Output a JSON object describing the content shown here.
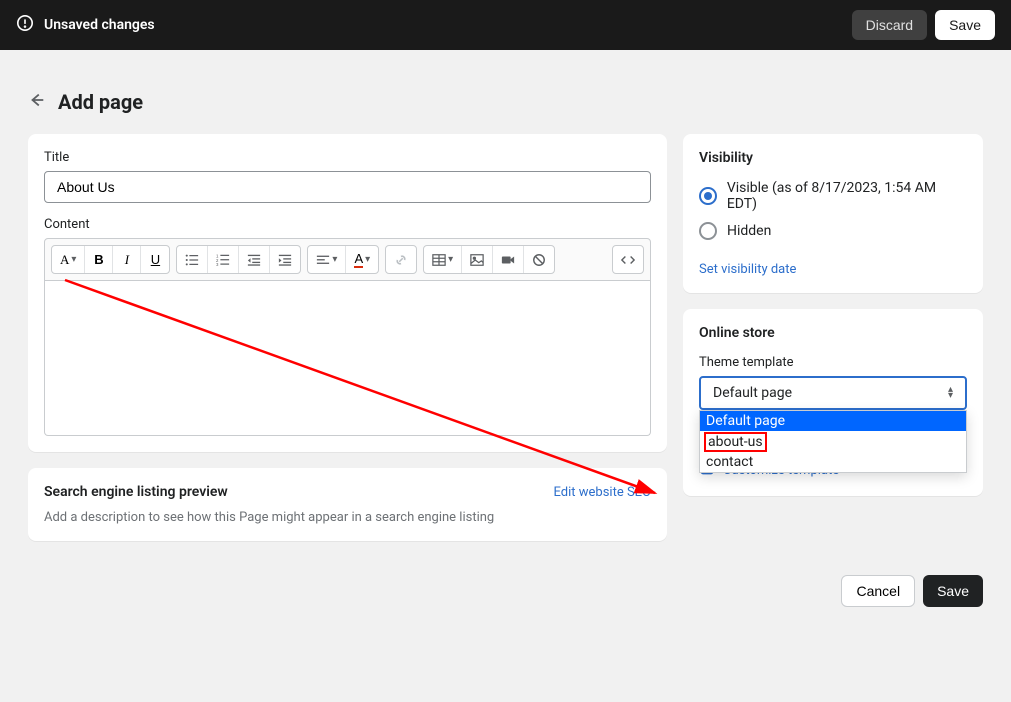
{
  "topbar": {
    "unsaved_label": "Unsaved changes",
    "discard_label": "Discard",
    "save_label": "Save"
  },
  "header": {
    "title": "Add page"
  },
  "title_field": {
    "label": "Title",
    "value": "About Us"
  },
  "content_field": {
    "label": "Content"
  },
  "toolbar_icons": {
    "font": "A",
    "bold": "B",
    "italic": "I",
    "underline": "U"
  },
  "seo": {
    "heading": "Search engine listing preview",
    "edit_link": "Edit website SEO",
    "description": "Add a description to see how this Page might appear in a search engine listing"
  },
  "visibility": {
    "heading": "Visibility",
    "visible_label": "Visible (as of 8/17/2023, 1:54 AM EDT)",
    "hidden_label": "Hidden",
    "set_date_link": "Set visibility date"
  },
  "online_store": {
    "heading": "Online store",
    "template_label": "Theme template",
    "selected": "Default page",
    "options": [
      "Default page",
      "about-us",
      "contact"
    ],
    "customize_link": "Customize template"
  },
  "footer": {
    "cancel_label": "Cancel",
    "save_label": "Save"
  }
}
